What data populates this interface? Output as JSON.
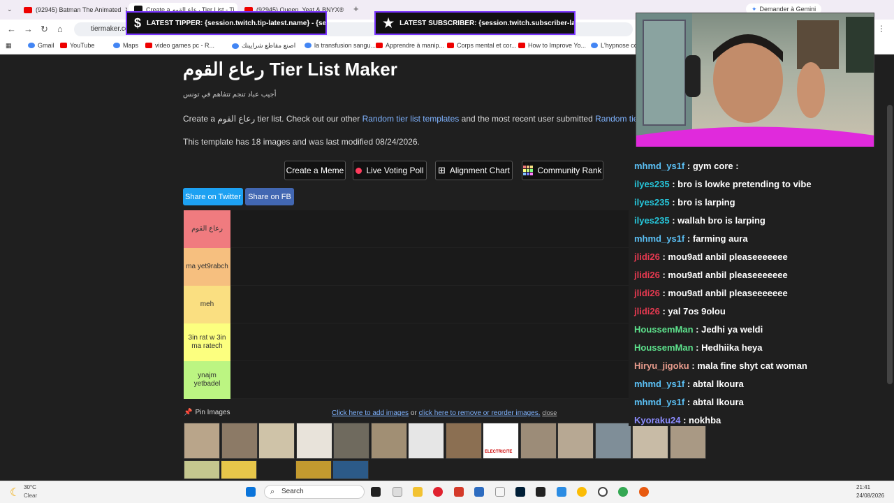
{
  "browser": {
    "tabs": [
      {
        "label": "(92945) Batman The Animated",
        "icon": "youtube-icon"
      },
      {
        "label": "Create a رعاع القوم Tier List - Ti",
        "icon": "tierlist-icon"
      },
      {
        "label": "(92945) Queen, Yeat & BNYX®",
        "icon": "youtube-icon"
      }
    ],
    "new_tab": "+",
    "gemini": "Demander à Gemini",
    "url": "tiermaker.com",
    "bookmarks": [
      "Gmail",
      "YouTube",
      "Maps",
      "video games pc - R...",
      "اصنع مقاطع شرايينك",
      "la transfusion sangu...",
      "Apprendre à manip...",
      "Corps mental et cor...",
      "How to Improve Yo...",
      "L'hypnose co"
    ]
  },
  "overlays": {
    "tipper_symbol": "$",
    "tipper": "LATEST TIPPER: {session.twitch.tip-latest.name} - {session.twitch.",
    "subscriber_symbol": "★",
    "subscriber": "LATEST SUBSCRIBER: {session.twitch.subscriber-latest.name}"
  },
  "page": {
    "title": "رعاع القوم Tier List Maker",
    "subtitle": "أجيب عباد تنجم تتفاهم في تونس",
    "desc_pre": "Create a رعاع القوم tier list. Check out our other",
    "desc_link1": "Random tier list templates",
    "desc_mid": "and the most recent user submitted",
    "desc_link2": "Random tier lists",
    "desc_end": ".",
    "info": "This template has 18 images and was last modified 08/24/2026.",
    "buttons": {
      "create_meme": "Create a Meme",
      "live_voting": "Live Voting Poll",
      "alignment": "Alignment Chart",
      "community": "Community Rank"
    },
    "share_twitter": "Share on Twitter",
    "share_fb": "Share on FB",
    "tiers": [
      {
        "label": "رعاع القوم",
        "color": "#f07b7f"
      },
      {
        "label": "ma yet9rabch",
        "color": "#f6bf7f"
      },
      {
        "label": "meh",
        "color": "#fadf81"
      },
      {
        "label": "3in rat w 3in ma ratech",
        "color": "#fcff7f"
      },
      {
        "label": "ynajm yetbadel",
        "color": "#bcf582"
      }
    ],
    "pin_images": "Pin Images",
    "add_images_link": "Click here to add images",
    "or": "or",
    "remove_link": "click here to remove or reorder images.",
    "close": "close",
    "thumb_text": "ELECTRICITE"
  },
  "chat": [
    {
      "user": "mhmd_ys1f",
      "text": "gym core :",
      "color": "#5bc0f5"
    },
    {
      "user": "ilyes235",
      "text": "bro is lowke pretending to vibe",
      "color": "#26c6da"
    },
    {
      "user": "ilyes235",
      "text": "bro is larping",
      "color": "#26c6da"
    },
    {
      "user": "ilyes235",
      "text": "wallah bro is larping",
      "color": "#26c6da"
    },
    {
      "user": "mhmd_ys1f",
      "text": "farming aura",
      "color": "#5bc0f5"
    },
    {
      "user": "jlidi26",
      "text": "mou9atl anbil pleaseeeeeee",
      "color": "#e53950"
    },
    {
      "user": "jlidi26",
      "text": "mou9atl anbil pleaseeeeeee",
      "color": "#e53950"
    },
    {
      "user": "jlidi26",
      "text": "mou9atl anbil pleaseeeeeee",
      "color": "#e53950"
    },
    {
      "user": "jlidi26",
      "text": "yal 7os 9olou",
      "color": "#e53950"
    },
    {
      "user": "HoussemMan",
      "text": "Jedhi ya weldi",
      "color": "#5de28c"
    },
    {
      "user": "HoussemMan",
      "text": "Hedhiika heya",
      "color": "#5de28c"
    },
    {
      "user": "Hiryu_jigoku",
      "text": "mala fine shyt cat woman",
      "color": "#e89b8c"
    },
    {
      "user": "mhmd_ys1f",
      "text": "abtal lkoura",
      "color": "#5bc0f5"
    },
    {
      "user": "mhmd_ys1f",
      "text": "abtal lkoura",
      "color": "#5bc0f5"
    },
    {
      "user": "Kyoraku24",
      "text": "nokhba",
      "color": "#8c8cff"
    }
  ],
  "taskbar": {
    "weather_temp": "30°C",
    "weather_text": "Clear",
    "search": "Search",
    "time": "21:41",
    "date": "24/08/2026"
  }
}
